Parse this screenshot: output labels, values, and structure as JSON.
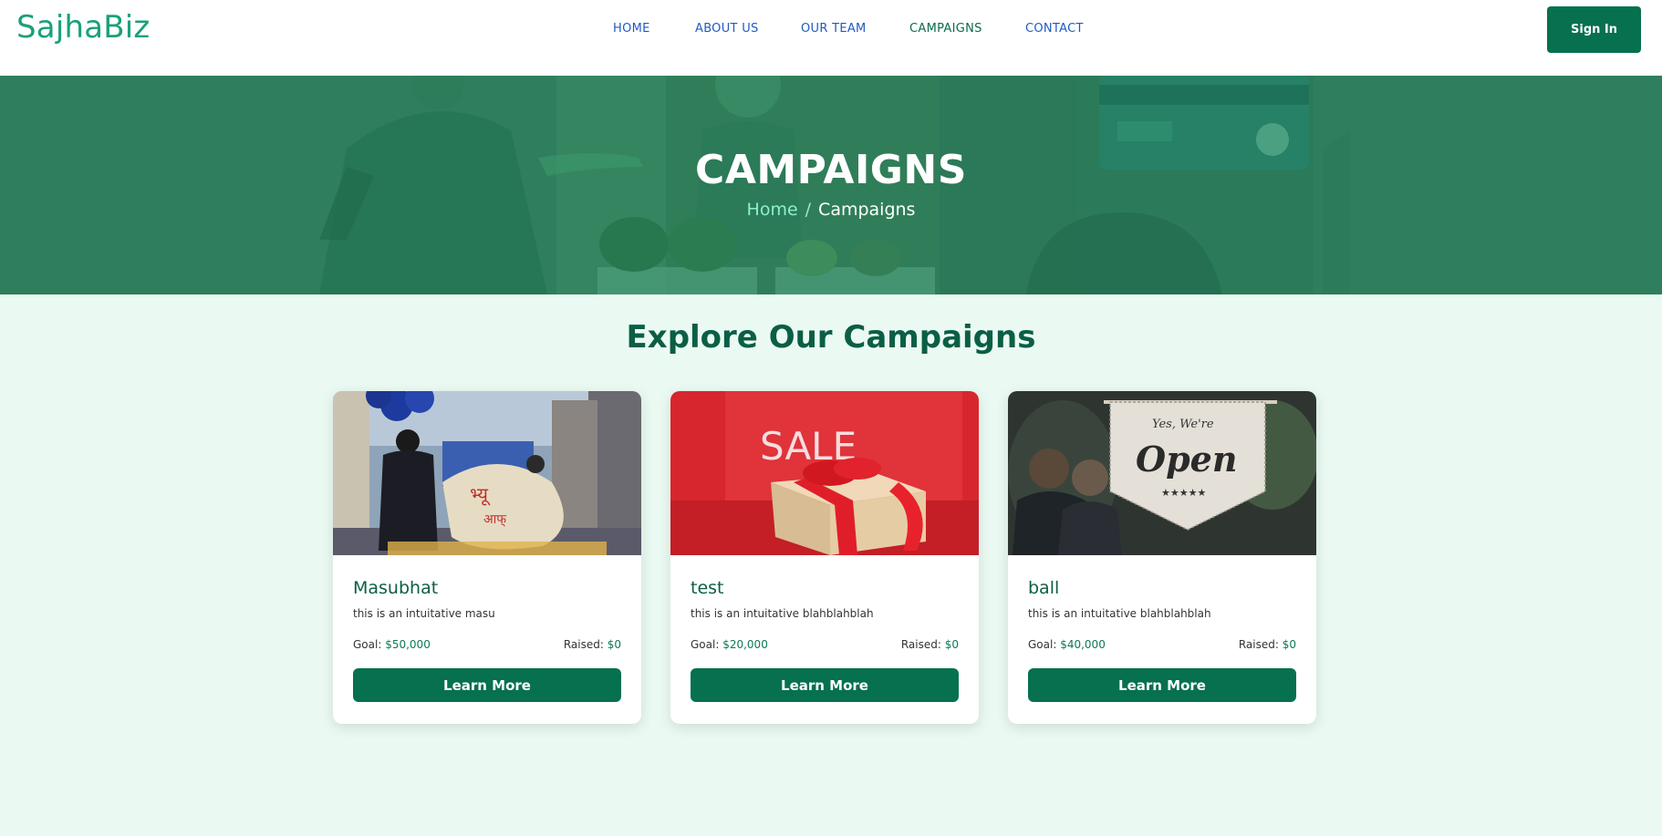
{
  "brand": {
    "name": "SajhaBiz",
    "color": "#1aa07a"
  },
  "nav": {
    "items": [
      {
        "label": "HOME",
        "active": false
      },
      {
        "label": "ABOUT US",
        "active": false
      },
      {
        "label": "OUR TEAM",
        "active": false
      },
      {
        "label": "CAMPAIGNS",
        "active": true
      },
      {
        "label": "CONTACT",
        "active": false
      }
    ],
    "signin_label": "Sign In"
  },
  "hero": {
    "title": "CAMPAIGNS",
    "breadcrumb": {
      "home": "Home",
      "separator": "/",
      "current": "Campaigns"
    }
  },
  "section": {
    "title": "Explore Our Campaigns"
  },
  "campaigns": [
    {
      "name": "Masubhat",
      "description": "this is an intuitative masu",
      "goal_label": "Goal:",
      "goal": "$50,000",
      "raised_label": "Raised:",
      "raised": "$0",
      "button": "Learn More"
    },
    {
      "name": "test",
      "description": "this is an intuitative blahblahblah",
      "goal_label": "Goal:",
      "goal": "$20,000",
      "raised_label": "Raised:",
      "raised": "$0",
      "button": "Learn More",
      "image_text": "SALE"
    },
    {
      "name": "ball",
      "description": "this is an intuitative blahblahblah",
      "goal_label": "Goal:",
      "goal": "$40,000",
      "raised_label": "Raised:",
      "raised": "$0",
      "button": "Learn More",
      "image_text_1": "Yes, We're",
      "image_text_2": "Open"
    }
  ],
  "colors": {
    "primary": "#06704f",
    "hero_bg": "#2f7e5e",
    "page_bg": "#eafaf2",
    "accent_text": "#0b5e45"
  }
}
